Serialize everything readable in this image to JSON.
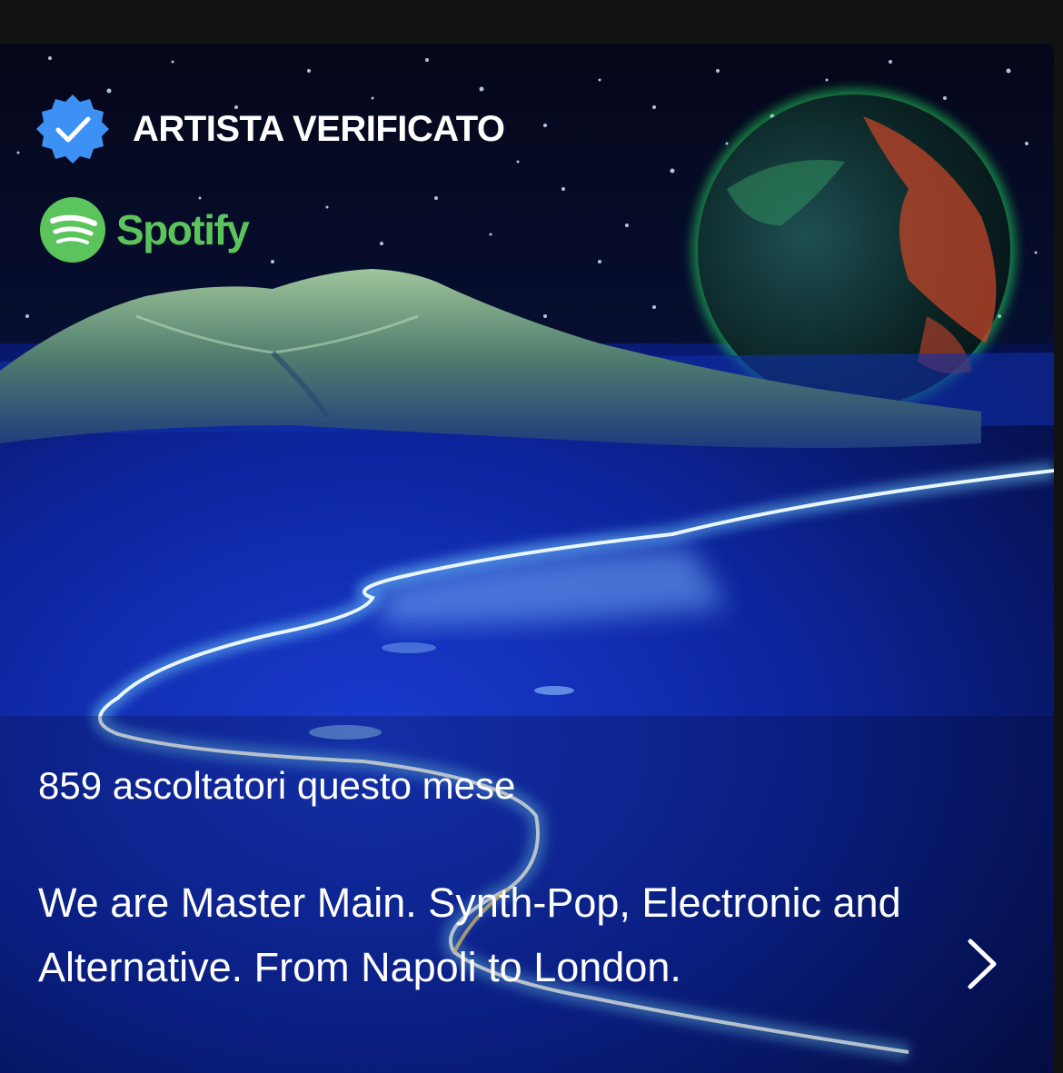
{
  "artist_card": {
    "verified_label": "ARTISTA VERIFICATO",
    "brand_name": "Spotify",
    "monthly_listeners": "859 ascoltatori questo mese",
    "bio": "We are Master Main. Synth-Pop, Electronic and Alternative. From Napoli to London."
  },
  "icons": {
    "verified": "verified-badge-icon",
    "brand": "spotify-logo-icon",
    "open": "chevron-right-icon"
  },
  "colors": {
    "verified_blue": "#3d91f4",
    "spotify_green": "#5cc45c",
    "text": "#ffffff",
    "background": "#121212"
  }
}
